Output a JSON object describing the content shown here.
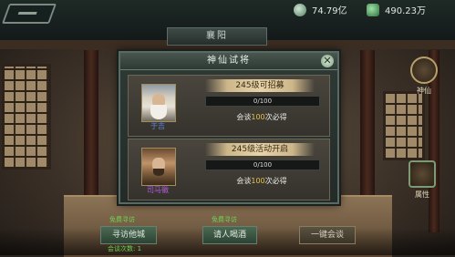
{
  "hud": {
    "gold_amount": "74.79亿",
    "silver_amount": "490.23万",
    "city_name": "襄阳",
    "side_xian_label": "神仙",
    "side_attr_label": "属性"
  },
  "dialog": {
    "title": "神仙试将",
    "close_label": "✕",
    "cards": [
      {
        "header": "245级可招募",
        "general_name": "于吉",
        "progress_text": "0/100",
        "progress_fraction": 0,
        "talk_prefix": "会谈",
        "talk_count": "100",
        "talk_suffix": "次必得"
      },
      {
        "header": "245级活动开启",
        "general_name": "司马徽",
        "progress_text": "0/100",
        "progress_fraction": 0,
        "talk_prefix": "会谈",
        "talk_count": "100",
        "talk_suffix": "次必得"
      }
    ]
  },
  "bottom": {
    "label_left": "免费寻访",
    "label_mid": "免费寻访",
    "label_bottom": "会谈次数: 1",
    "visit_button": "寻访他城",
    "wine_button": "请人喝酒",
    "oneclick_button": "一键会谈"
  },
  "colors": {
    "name_blue": "#5a87e0",
    "name_purple": "#b05bd9",
    "talk_highlight": "#e6c24a",
    "free_label_green": "#6ed654"
  }
}
